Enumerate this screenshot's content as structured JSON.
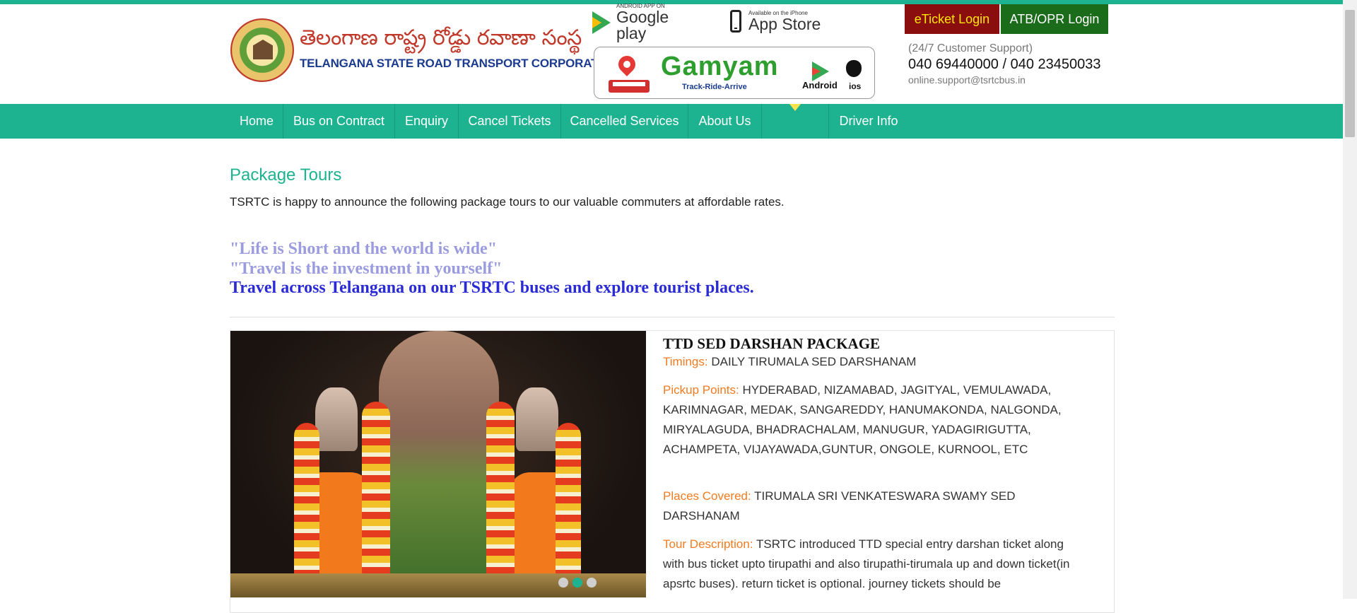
{
  "header": {
    "logo_telugu": "తెలంగాణ రాష్ట్ర రోడ్డు రవాణా సంస్థ",
    "logo_english": "TELANGANA STATE ROAD TRANSPORT CORPORATION",
    "google_play_small": "ANDROID APP ON",
    "google_play_big": "Google play",
    "app_store_small": "Available on the iPhone",
    "app_store_big": "App Store",
    "gamyam": {
      "title": "Gamyam",
      "tagline": "Track-Ride-Arrive",
      "android": "Android",
      "ios": "ios"
    },
    "eticket_login": "eTicket Login",
    "atb_login": "ATB/OPR Login",
    "support_label": "(24/7 Customer Support)",
    "support_phone": "040 69440000 / 040 23450033",
    "support_email": "online.support@tsrtcbus.in"
  },
  "nav": {
    "items": [
      {
        "label": "Home"
      },
      {
        "label": "Bus on Contract"
      },
      {
        "label": "Enquiry"
      },
      {
        "label": "Cancel Tickets"
      },
      {
        "label": "Cancelled Services"
      },
      {
        "label": "About Us"
      },
      {
        "label": ""
      },
      {
        "label": "Driver Info"
      }
    ]
  },
  "content": {
    "title": "Package Tours",
    "intro": "TSRTC is happy to announce the following package tours to our valuable commuters at affordable rates.",
    "quote1": "\"Life is Short and the world is wide\"",
    "quote2": "\"Travel is the investment in yourself\"",
    "quote3": "Travel across Telangana on our TSRTC buses and explore tourist places."
  },
  "package": {
    "title": "TTD SED DARSHAN PACKAGE",
    "timings_label": "Timings:",
    "timings": "DAILY TIRUMALA SED DARSHANAM",
    "pickup_label": "Pickup Points:",
    "pickup": "HYDERABAD, NIZAMABAD, JAGITYAL, VEMULAWADA, KARIMNAGAR, MEDAK, SANGAREDDY, HANUMAKONDA, NALGONDA, MIRYALAGUDA, BHADRACHALAM, MANUGUR, YADAGIRIGUTTA, ACHAMPETA, VIJAYAWADA,GUNTUR, ONGOLE, KURNOOL, ETC",
    "places_label": "Places Covered:",
    "places": "TIRUMALA SRI VENKATESWARA SWAMY SED DARSHANAM",
    "desc_label": "Tour Description:",
    "desc": "TSRTC introduced TTD special entry darshan ticket along with bus ticket upto tirupathi and also tirupathi-tirumala up and down ticket(in apsrtc buses). return ticket is optional. journey tickets should be"
  },
  "carousel": {
    "slide_count": 3,
    "active_index": 1
  },
  "colors": {
    "accent": "#1db391",
    "eticket_bg": "#8b0e0e",
    "eticket_text": "#ffe600",
    "atb_bg": "#1a6b1a",
    "label_orange": "#f47b20",
    "quote_light": "#9b9be0",
    "quote_dark": "#2b2bd6"
  }
}
